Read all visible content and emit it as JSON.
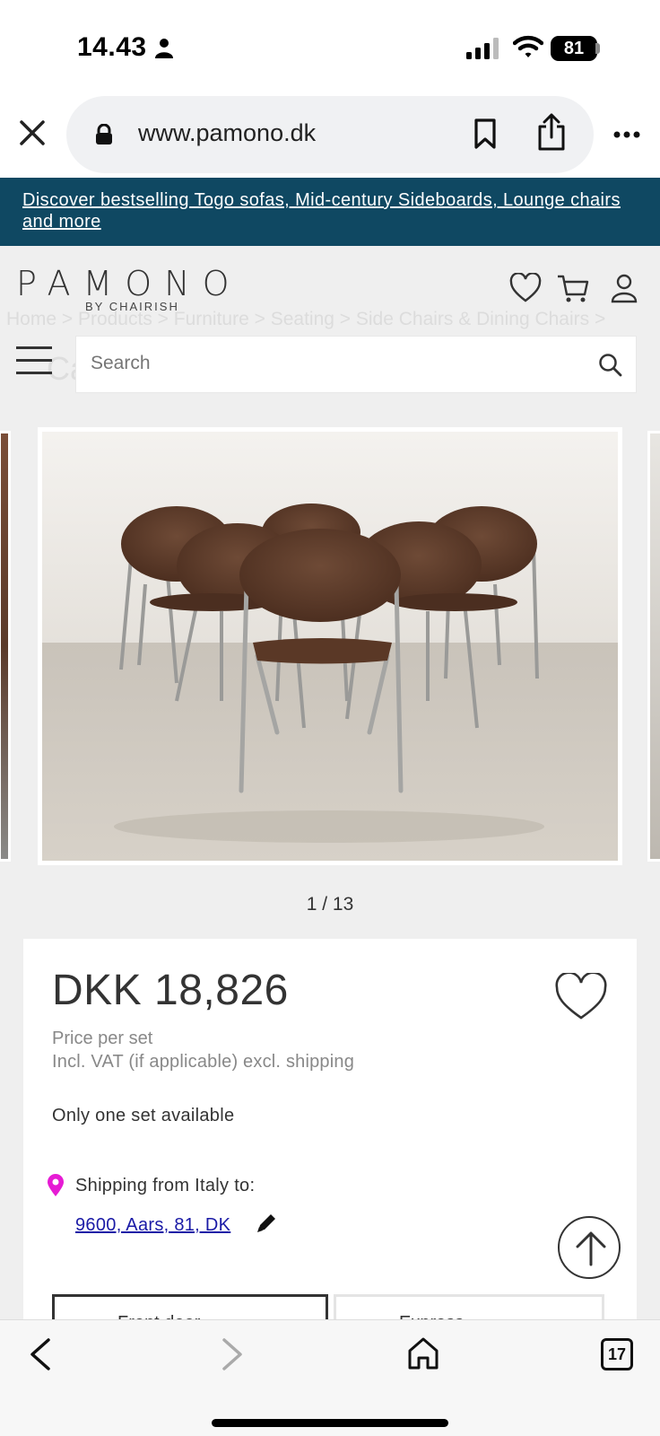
{
  "status_bar": {
    "time": "14.43",
    "battery": "81"
  },
  "browser": {
    "url": "www.pamono.dk",
    "tab_count": "17"
  },
  "banner": {
    "text": "Discover bestselling Togo sofas, Mid-century Sideboards, Lounge chairs and more"
  },
  "header": {
    "logo": "PAMONO",
    "logo_sub": "BY CHAIRISH",
    "breadcrumb": "Home > Products > Furniture > Seating > Side Chairs & Dining Chairs >",
    "search_placeholder": "Search",
    "ghost_title": "Ca"
  },
  "gallery": {
    "counter": "1 / 13"
  },
  "product": {
    "price": "DKK 18,826",
    "price_note": "Price per set",
    "vat_note": "Incl. VAT (if applicable) excl. shipping",
    "availability": "Only one set available",
    "shipping_label": "Shipping from Italy to:",
    "shipping_address": "9600, Aars, 81, DK",
    "shipping_option_1": "Front door",
    "shipping_option_2": "Express"
  },
  "colors": {
    "banner_bg": "#0f4862",
    "link": "#1a1aa6",
    "pin": "#e61bd4"
  },
  "icons": [
    "person-icon",
    "signal-icon",
    "wifi-icon",
    "close-icon",
    "lock-icon",
    "bookmark-icon",
    "share-icon",
    "more-icon",
    "heart-icon",
    "cart-icon",
    "user-icon",
    "menu-icon",
    "search-icon",
    "pin-icon",
    "pencil-icon",
    "arrow-up-icon",
    "back-icon",
    "forward-icon",
    "home-icon"
  ]
}
